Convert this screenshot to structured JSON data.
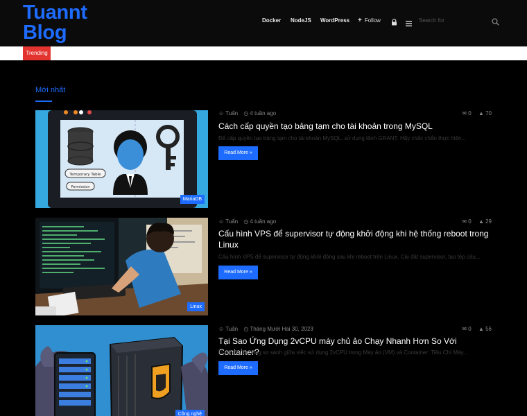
{
  "header": {
    "logo_line1": "Tuannt",
    "logo_line2": "Blog",
    "nav": [
      "Docker",
      "NodeJS",
      "WordPress"
    ],
    "follow_label": "Follow",
    "search_placeholder": "Search for"
  },
  "trending_label": "Trending",
  "section_title": "Mới nhất",
  "colors": {
    "accent": "#1e6cff",
    "trending": "#e3342f",
    "background": "#000000"
  },
  "posts": [
    {
      "author": "Tuấn",
      "date": "4 tuần ago",
      "comments": "0",
      "views": "70",
      "title": "Cách cấp quyền tạo bảng tạm cho tài khoản trong MySQL",
      "excerpt": "Để cấp quyền tạo bảng tạm cho tài khoản MySQL, sử dụng lệnh GRANT. Hãy chắc chắn thực hiện...",
      "category": "MariaDB",
      "thumb_labels": [
        "Temporary Table",
        "Permission"
      ],
      "read_more": "Read More »"
    },
    {
      "author": "Tuấn",
      "date": "4 tuần ago",
      "comments": "0",
      "views": "29",
      "title": "Cấu hình VPS để supervisor tự động khởi động khi hệ thống reboot trong Linux",
      "excerpt": "Cấu hình VPS để supervisor tự động khởi động sau khi reboot trên Linux. Cài đặt supervisor, tạo tệp cấu...",
      "category": "Linux",
      "read_more": "Read More »"
    },
    {
      "author": "Tuấn",
      "date": "Tháng Mười Hai 30, 2023",
      "comments": "0",
      "views": "56",
      "title": "Tại Sao Ứng Dụng 2vCPU máy chủ ảo Chạy Nhanh Hơn So Với Container?",
      "excerpt": "Dưới đây là bảng so sánh giữa việc sử dụng 2vCPU trong Máy ảo (VM) và Container: Tiêu Chí Máy...",
      "category": "Công nghệ",
      "read_more": "Read More »"
    }
  ]
}
